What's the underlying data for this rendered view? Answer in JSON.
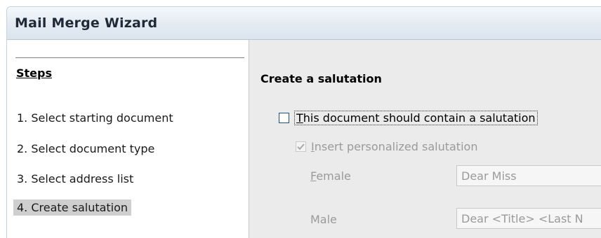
{
  "window": {
    "title": "Mail Merge Wizard"
  },
  "steps": {
    "heading": "Steps",
    "items": [
      {
        "label": "1. Select starting document"
      },
      {
        "label": "2. Select document type"
      },
      {
        "label": "3. Select address list"
      },
      {
        "label": "4. Create salutation",
        "active": true
      }
    ]
  },
  "salutation": {
    "title": "Create a salutation",
    "contain_checkbox": {
      "label_first": "T",
      "label_rest": "his document should contain a salutation",
      "checked": false
    },
    "personalized_checkbox": {
      "label_first": "I",
      "label_rest": "nsert personalized salutation",
      "checked": true,
      "enabled": false
    },
    "female": {
      "label_first": "F",
      "label_rest": "emale",
      "value": "Dear Miss"
    },
    "male": {
      "label": "Male",
      "value": "Dear <Title> <Last N"
    }
  },
  "colors": {
    "selected_step": "#cfcfcf",
    "panel_bg": "#ebebeb",
    "checkbox_border": "#1c5180"
  },
  "icons": {
    "checkmark": "check-icon"
  }
}
